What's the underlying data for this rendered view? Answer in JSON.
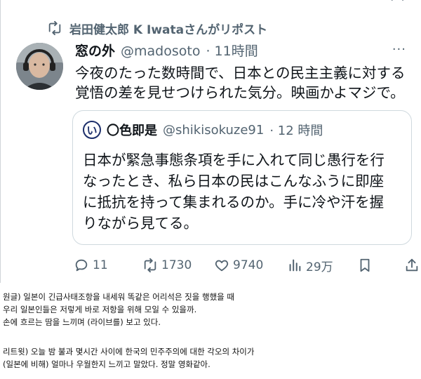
{
  "repost": {
    "label": "岩田健太郎 K Iwataさんがリポスト"
  },
  "tweet": {
    "name": "窓の外",
    "handle": "@madosoto",
    "time": "· 11時間",
    "more": "···",
    "text_lines": [
      "今夜のたった数時間で、日本との民主主義に対する",
      "覚悟の差を見せつけられた気分。映画かよマジで。"
    ]
  },
  "quote": {
    "avatar_char": "い",
    "name": "〇色即是",
    "handle": "@shikisokuze91",
    "time": "· 12 時間",
    "text_lines": [
      "日本が緊急事態条項を手に入れて同じ愚行を行",
      "なったとき、私ら日本の民はこんなふうに即座",
      "に抵抗を持って集まれるのか。手に冷や汗を握",
      "りながら見てる。"
    ]
  },
  "actions": {
    "replies": "11",
    "reposts": "1730",
    "likes": "9740",
    "views": "29万"
  },
  "caption": {
    "original": [
      "원글) 일본이 긴급사태조항을 내세워 똑같은 어리석은 짓을 행했을 때",
      "우리 일본인들은 저렇게 바로 저항을 위해 모일 수 있을까.",
      "손에 흐르는 땀을 느끼며 (라이브를) 보고 있다."
    ],
    "retweet": [
      "리트윗) 오늘 밤 불과 몇시간 사이에 한국의 민주주의에 대한 각오의 차이가",
      "(일본에 비해) 얼마나 우월한지 느끼고 말았다. 정말 영화같아."
    ]
  },
  "icons": [
    "repost-icon",
    "reply-icon",
    "like-icon",
    "views-icon",
    "bookmark-icon",
    "share-icon",
    "more-icon"
  ],
  "colors": {
    "text": "#0f1419",
    "muted": "#536471",
    "border": "#cfd9de"
  }
}
